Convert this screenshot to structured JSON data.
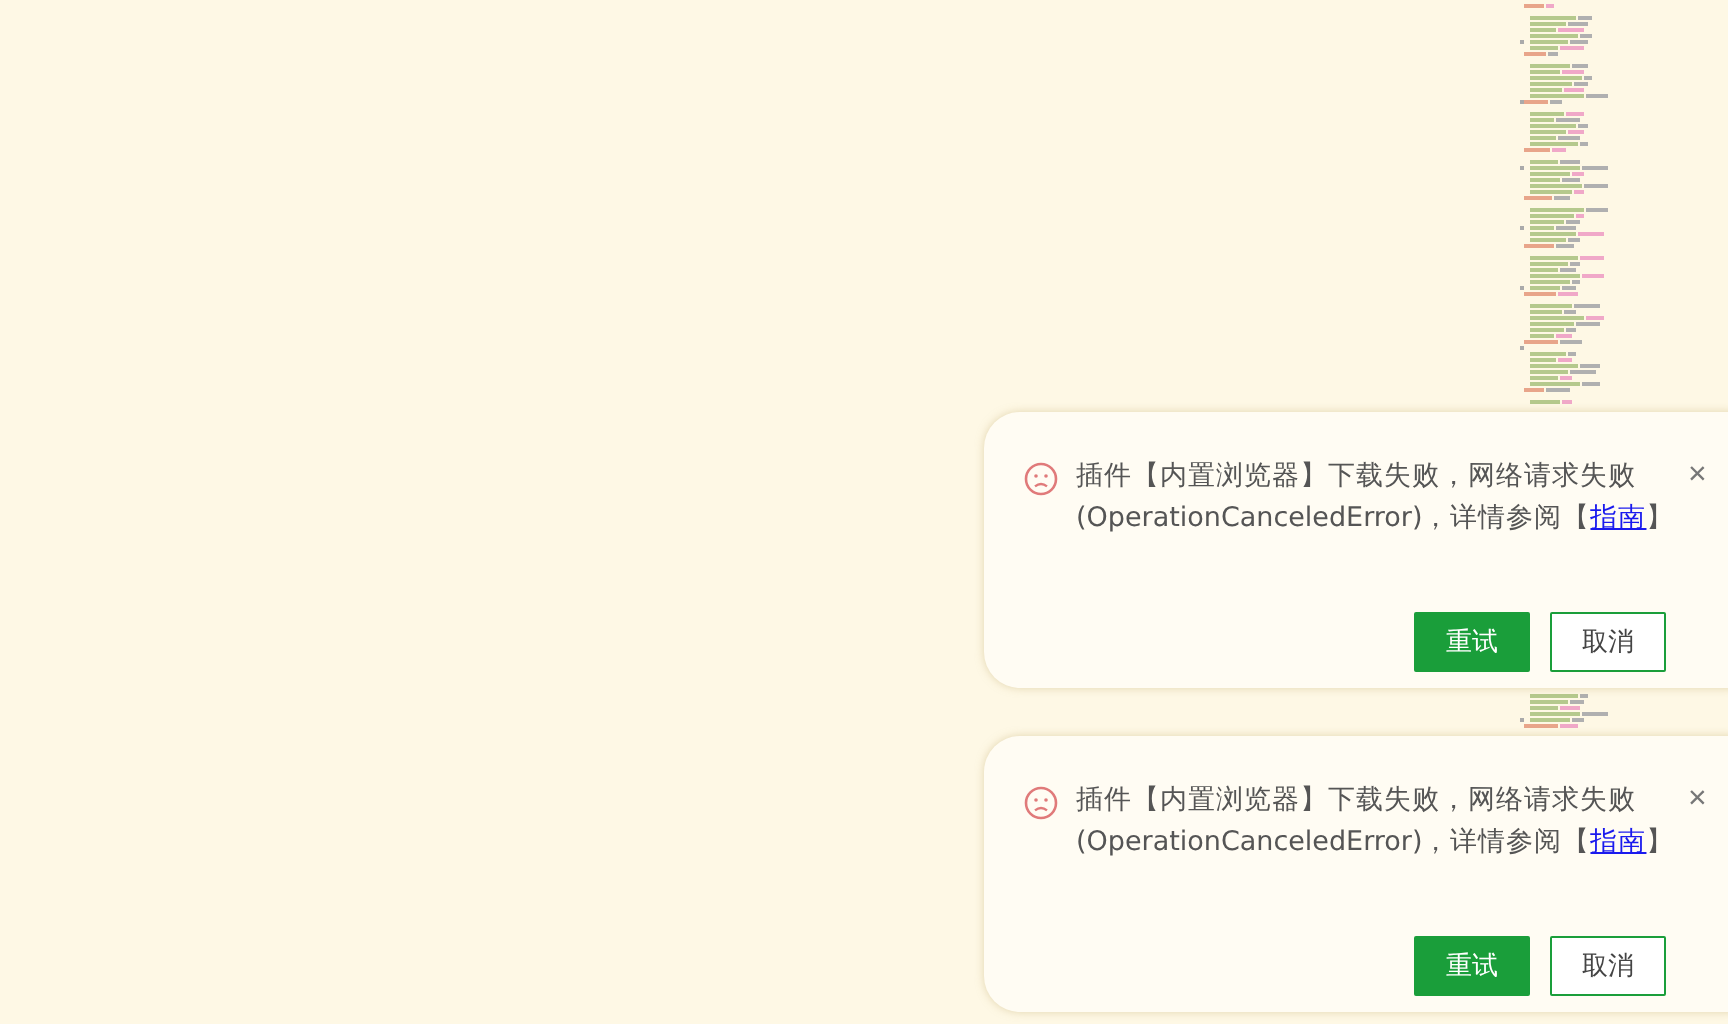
{
  "notifications": [
    {
      "message": {
        "before": "插件【内置浏览器】下载失败，网络请求失败(OperationCanceledError)，详情参阅【",
        "link": "指南",
        "after": "】"
      },
      "close": "×",
      "buttons": [
        {
          "label": "重试",
          "kind": "primary"
        },
        {
          "label": "取消",
          "kind": "secondary"
        }
      ]
    },
    {
      "message": {
        "before": "插件【内置浏览器】下载失败，网络请求失败(OperationCanceledError)，详情参阅【",
        "link": "指南",
        "after": "】"
      },
      "close": "×",
      "buttons": [
        {
          "label": "重试",
          "kind": "primary"
        },
        {
          "label": "取消",
          "kind": "secondary"
        }
      ]
    }
  ]
}
